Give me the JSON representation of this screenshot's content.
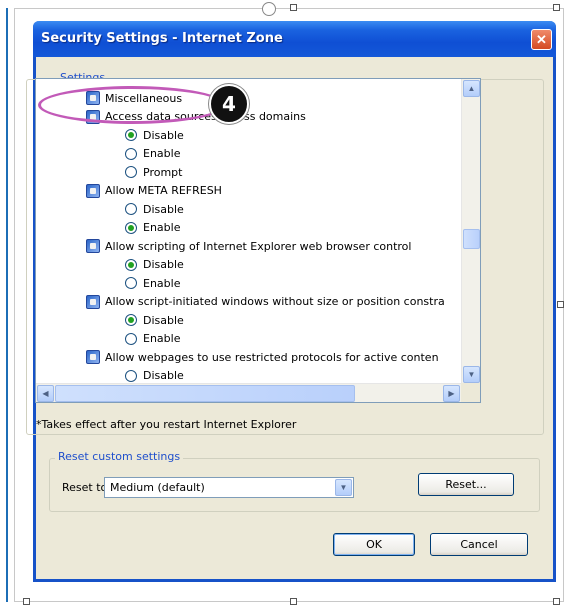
{
  "window": {
    "title": "Security Settings - Internet Zone",
    "close_symbol": "✕"
  },
  "settings_group": {
    "label": "Settings"
  },
  "tree": {
    "rows": [
      {
        "kind": "category",
        "label": "Miscellaneous"
      },
      {
        "kind": "category",
        "label": "Access data sources across domains"
      },
      {
        "kind": "option",
        "label": "Disable",
        "selected": true
      },
      {
        "kind": "option",
        "label": "Enable",
        "selected": false
      },
      {
        "kind": "option",
        "label": "Prompt",
        "selected": false
      },
      {
        "kind": "category",
        "label": "Allow META REFRESH"
      },
      {
        "kind": "option",
        "label": "Disable",
        "selected": false
      },
      {
        "kind": "option",
        "label": "Enable",
        "selected": true
      },
      {
        "kind": "category",
        "label": "Allow scripting of Internet Explorer web browser control"
      },
      {
        "kind": "option",
        "label": "Disable",
        "selected": true
      },
      {
        "kind": "option",
        "label": "Enable",
        "selected": false
      },
      {
        "kind": "category",
        "label": "Allow script-initiated windows without size or position constra"
      },
      {
        "kind": "option",
        "label": "Disable",
        "selected": true
      },
      {
        "kind": "option",
        "label": "Enable",
        "selected": false
      },
      {
        "kind": "category",
        "label": "Allow webpages to use restricted protocols for active conten"
      },
      {
        "kind": "option",
        "label": "Disable",
        "selected": false
      }
    ]
  },
  "scroll": {
    "up": "▲",
    "down": "▼",
    "left": "◀",
    "right": "▶"
  },
  "note": "*Takes effect after you restart Internet Explorer",
  "reset_group": {
    "label": "Reset custom settings",
    "reset_to_label": "Reset to:",
    "selected_level": "Medium (default)",
    "dropdown_symbol": "▼",
    "reset_button": "Reset..."
  },
  "footer": {
    "ok_button": "OK",
    "cancel_button": "Cancel"
  },
  "annotation": {
    "step_number": "4"
  },
  "colors": {
    "title_bar": "#1a63e0",
    "group_label": "#1f4fcc",
    "callout": "#c25ab8",
    "radio_dot": "#21a121"
  }
}
